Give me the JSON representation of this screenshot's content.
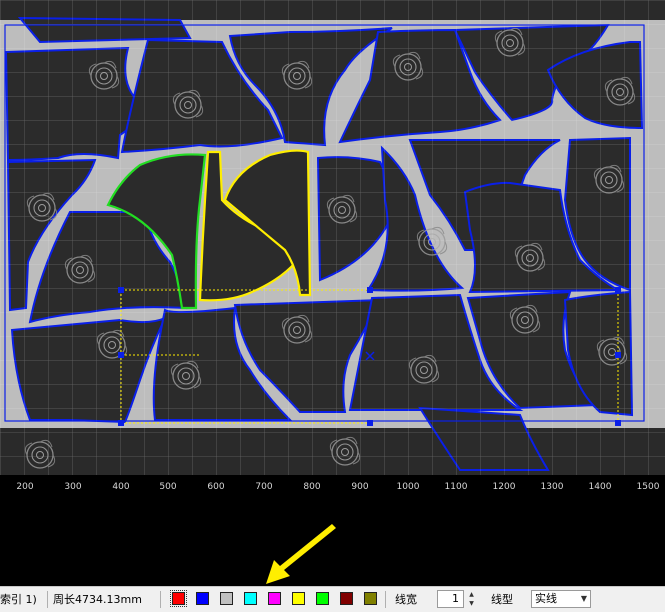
{
  "ruler": {
    "ticks": [
      "200",
      "300",
      "400",
      "500",
      "600",
      "700",
      "800",
      "900",
      "1000",
      "1100",
      "1200",
      "1300",
      "1400",
      "1500"
    ]
  },
  "status": {
    "index_text": "索引 1)",
    "perimeter_text": "周长4734.13mm",
    "line_width_label": "线宽",
    "line_width_value": "1",
    "line_type_label": "线型",
    "line_type_value": "实线"
  },
  "palette": [
    {
      "name": "red",
      "hex": "#ff0000"
    },
    {
      "name": "blue",
      "hex": "#0000ff"
    },
    {
      "name": "light-gray",
      "hex": "#c0c0c0"
    },
    {
      "name": "cyan",
      "hex": "#00ffff"
    },
    {
      "name": "magenta",
      "hex": "#ff00ff"
    },
    {
      "name": "yellow",
      "hex": "#ffff00"
    },
    {
      "name": "green",
      "hex": "#00ff00"
    },
    {
      "name": "dark-red",
      "hex": "#800000"
    },
    {
      "name": "olive",
      "hex": "#808000"
    }
  ],
  "colors": {
    "piece_outline": "#0a1fe8",
    "selected_green": "#22dd22",
    "selected_yellow": "#ffee00",
    "fabric": "#2b2b2b",
    "background": "#bdbdbd",
    "annotation_arrow": "#ffee00"
  }
}
